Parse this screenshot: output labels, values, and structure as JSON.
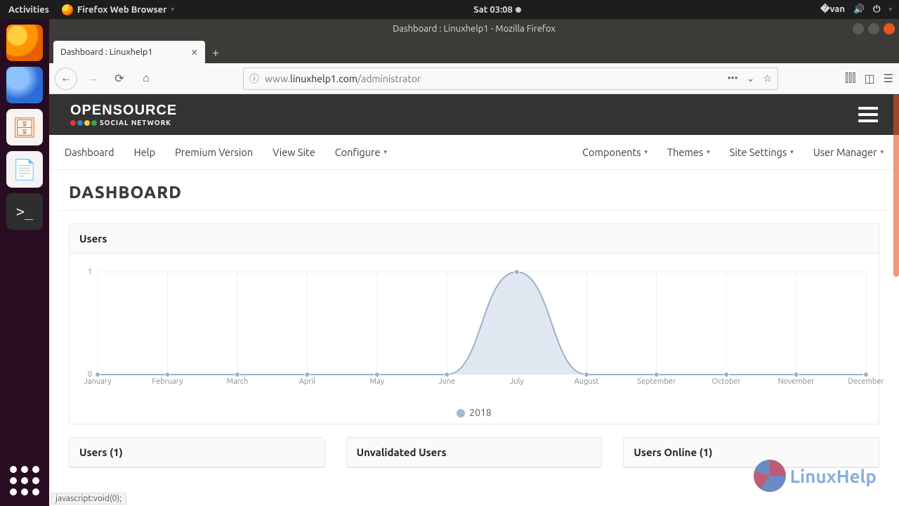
{
  "gnome": {
    "activities": "Activities",
    "app": "Firefox Web Browser",
    "clock": "Sat 03:08"
  },
  "firefox": {
    "window_title": "Dashboard : Linuxhelp1 - Mozilla Firefox",
    "tab_title": "Dashboard : Linuxhelp1",
    "url_prefix": "www.",
    "url_host": "linuxhelp1.com",
    "url_path": "/administrator",
    "status": "javascript:void(0);"
  },
  "app": {
    "logo_line1": "OPENSOURCE",
    "logo_line2": "SOCIAL NETWORK",
    "menu_left": [
      "Dashboard",
      "Help",
      "Premium Version",
      "View Site",
      "Configure"
    ],
    "menu_left_dropdown": [
      false,
      false,
      false,
      false,
      true
    ],
    "menu_right": [
      "Components",
      "Themes",
      "Site Settings",
      "User Manager"
    ],
    "page_heading": "DASHBOARD",
    "panel_users": "Users",
    "cards": {
      "users": "Users (1)",
      "unvalidated": "Unvalidated Users",
      "online": "Users Online (1)"
    }
  },
  "chart_data": {
    "type": "area",
    "title": "Users",
    "xlabel": "",
    "ylabel": "",
    "ylim": [
      0,
      1
    ],
    "legend": "2018",
    "categories": [
      "January",
      "February",
      "March",
      "April",
      "May",
      "June",
      "July",
      "August",
      "September",
      "October",
      "November",
      "December"
    ],
    "values": [
      0,
      0,
      0,
      0,
      0,
      0,
      1,
      0,
      0,
      0,
      0,
      0
    ]
  },
  "watermark": "LinuxHelp"
}
